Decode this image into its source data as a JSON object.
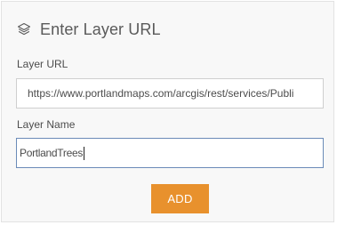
{
  "header": {
    "icon": "layers-icon",
    "title": "Enter Layer URL"
  },
  "form": {
    "url_label": "Layer URL",
    "url_value": "https://www.portlandmaps.com/arcgis/rest/services/Publi",
    "name_label": "Layer Name",
    "name_value": "PortlandTrees"
  },
  "actions": {
    "add_label": "ADD"
  },
  "colors": {
    "accent": "#e8912d",
    "focus_border": "#6b8bb8",
    "panel_bg": "#f8f8f8"
  }
}
